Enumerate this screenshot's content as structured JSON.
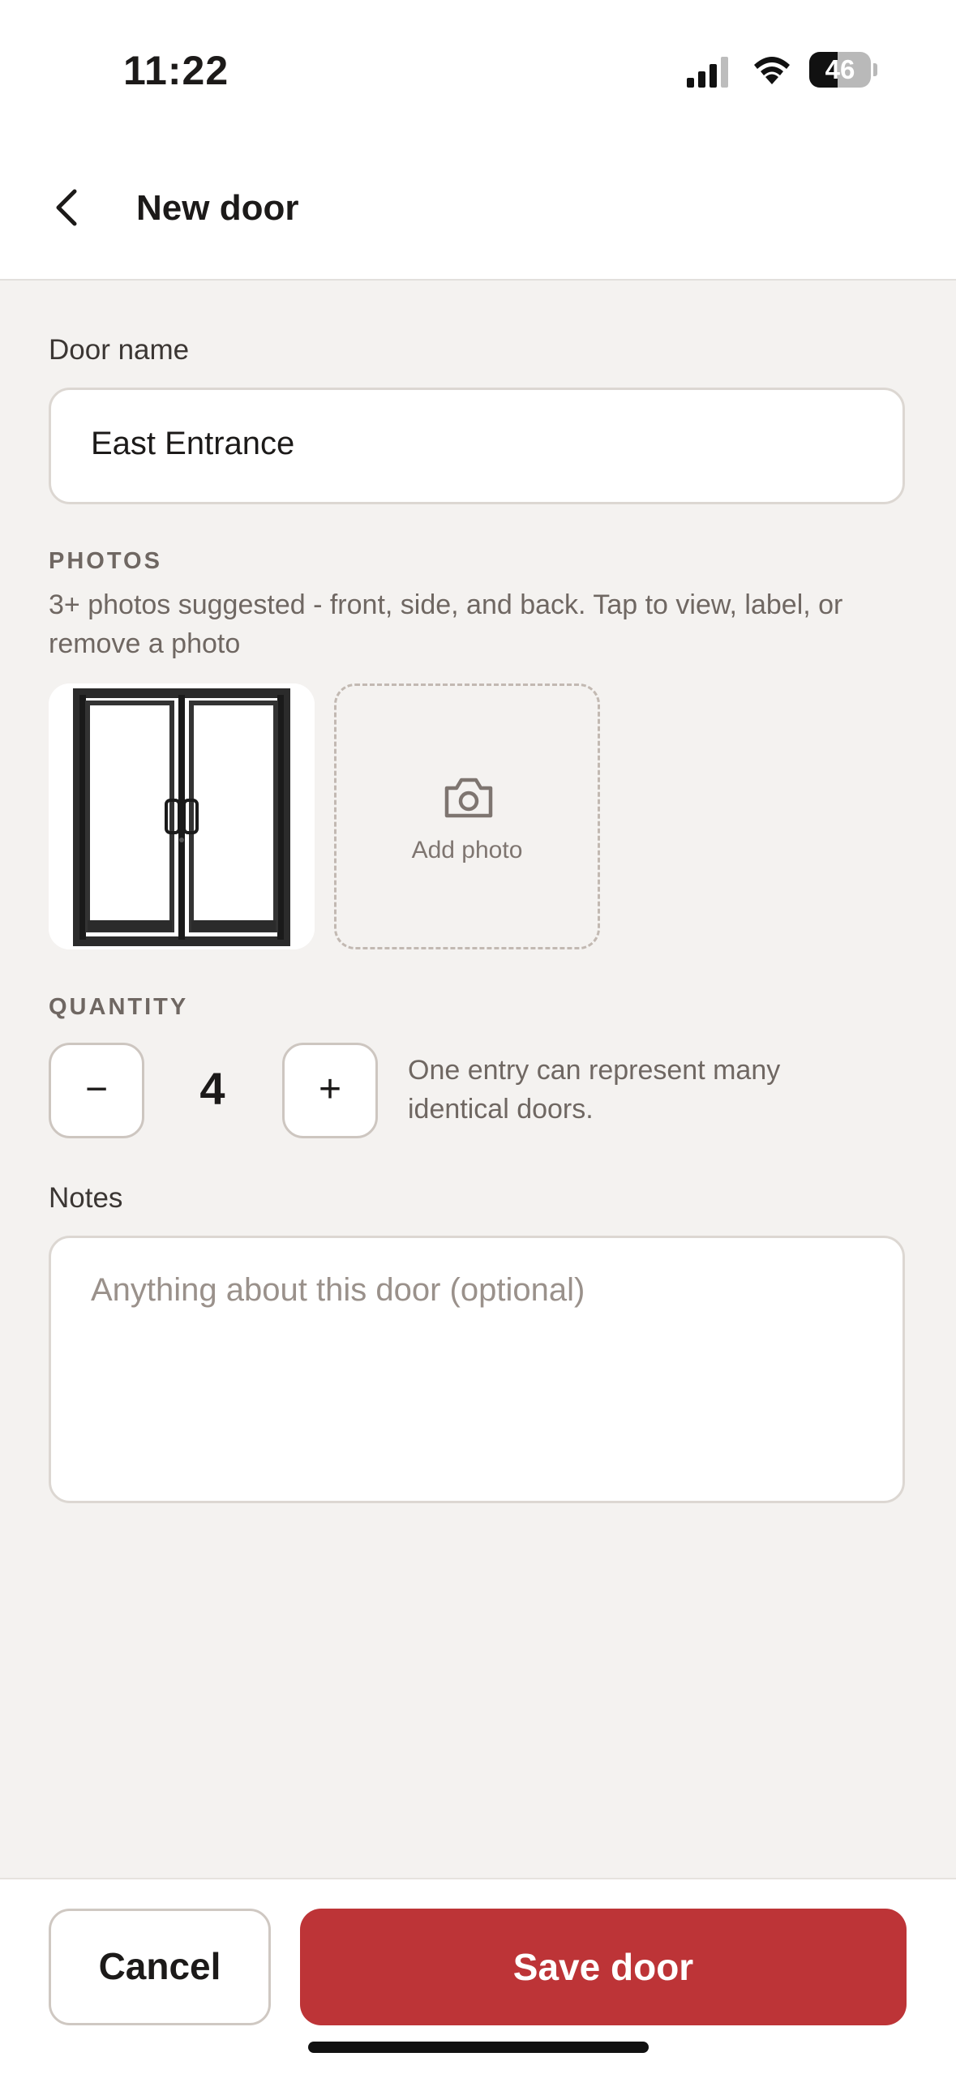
{
  "status": {
    "time": "11:22",
    "battery": "46"
  },
  "nav": {
    "title": "New door"
  },
  "form": {
    "door_name_label": "Door name",
    "door_name_value": "East Entrance",
    "photos_label": "PHOTOS",
    "photos_help": "3+ photos suggested - front, side, and back. Tap to view, label, or remove a photo",
    "add_photo_label": "Add photo",
    "quantity_label": "QUANTITY",
    "quantity_minus": "−",
    "quantity_value": "4",
    "quantity_plus": "+",
    "quantity_help": "One entry can represent many identical doors.",
    "notes_label": "Notes",
    "notes_placeholder": "Anything about this door (optional)"
  },
  "actions": {
    "cancel_label": "Cancel",
    "save_label": "Save door"
  },
  "colors": {
    "accent": "#bd3437",
    "background": "#f4f2f0"
  }
}
